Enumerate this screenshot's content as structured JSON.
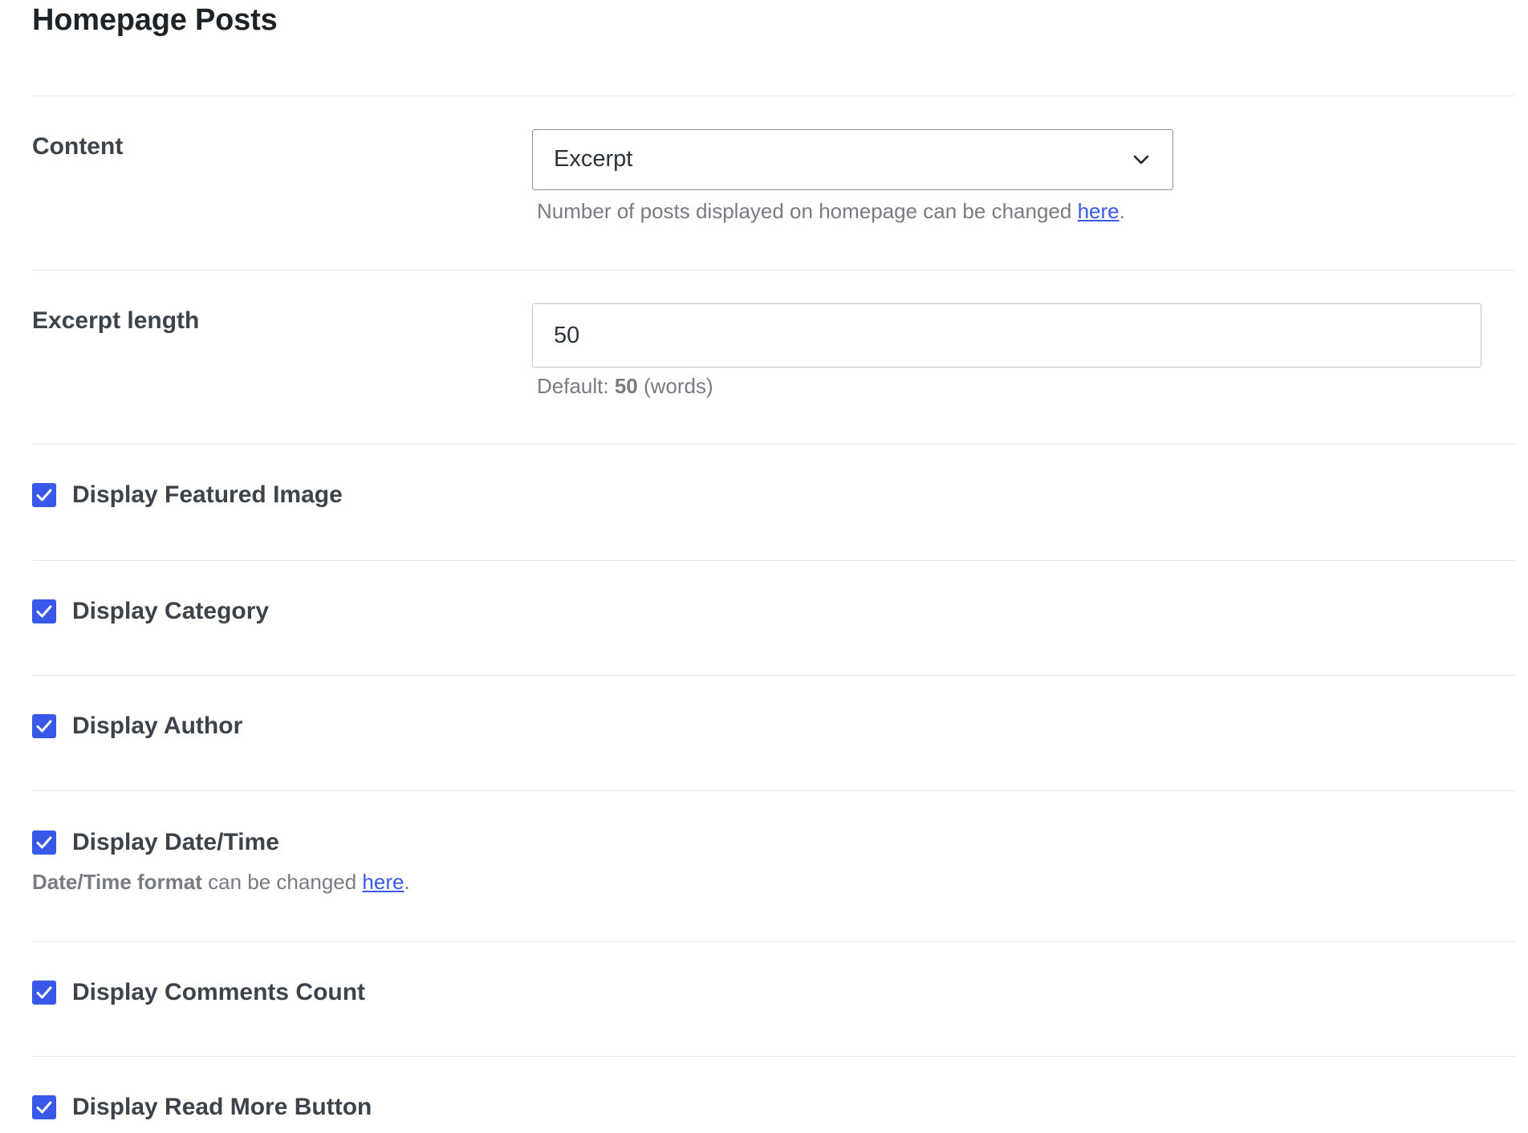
{
  "page": {
    "title": "Homepage Posts"
  },
  "content_field": {
    "label": "Content",
    "selected": "Excerpt",
    "help_text": "Number of posts displayed on homepage can be changed ",
    "help_link": "here",
    "help_suffix": "."
  },
  "excerpt_field": {
    "label": "Excerpt length",
    "value": "50",
    "help_prefix": "Default: ",
    "help_default": "50",
    "help_suffix": " (words)"
  },
  "checkboxes": [
    {
      "label": "Display Featured Image",
      "checked": true
    },
    {
      "label": "Display Category",
      "checked": true
    },
    {
      "label": "Display Author",
      "checked": true
    },
    {
      "label": "Display Date/Time",
      "checked": true
    },
    {
      "label": "Display Comments Count",
      "checked": true
    },
    {
      "label": "Display Read More Button",
      "checked": true
    }
  ],
  "datetime_help": {
    "bold": "Date/Time format",
    "text": " can be changed ",
    "link": "here",
    "suffix": "."
  },
  "colors": {
    "checkbox": "#3858e9",
    "link": "#3858e9",
    "heading": "#1d2327",
    "label": "#3c434a",
    "help": "#787c82"
  },
  "icons": {
    "dropdown": "chevron-down-icon",
    "checkbox": "checkmark-icon"
  }
}
